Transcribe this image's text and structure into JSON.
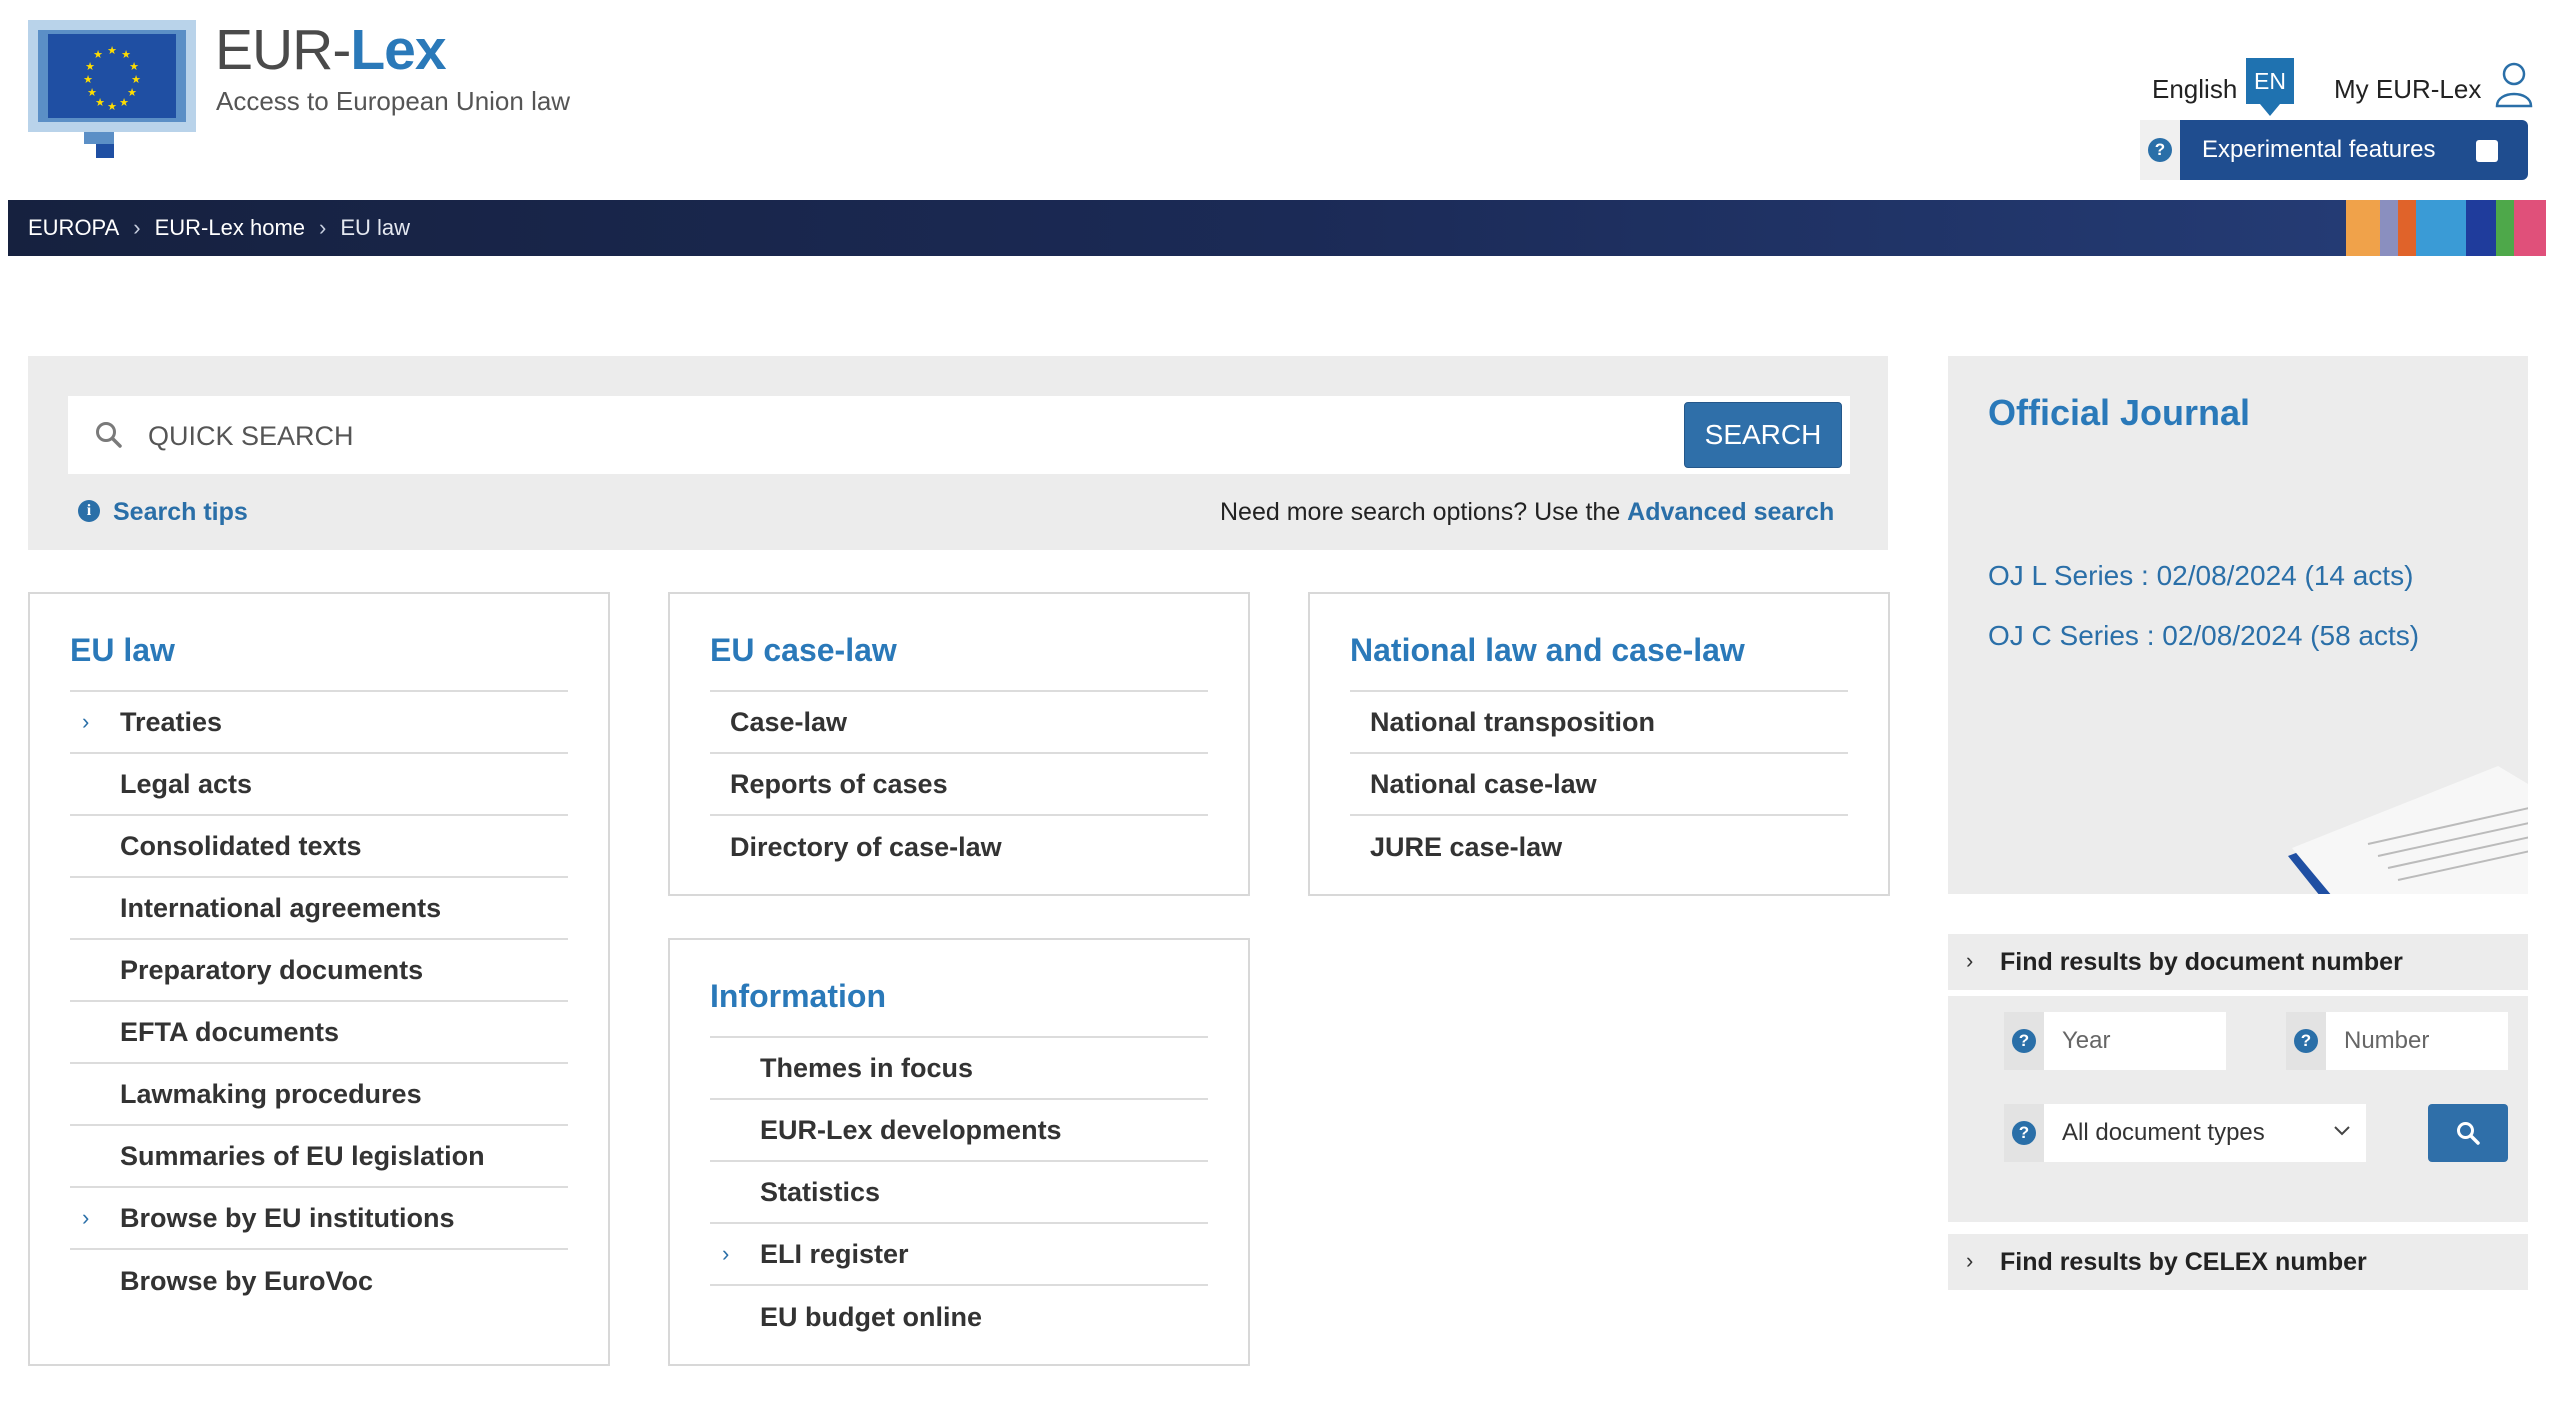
{
  "header": {
    "title_prefix": "EUR-",
    "title_strong": "Lex",
    "subtitle": "Access to European Union law",
    "language_label": "English",
    "language_code": "EN",
    "my_eurlex": "My EUR-Lex",
    "experimental_label": "Experimental features",
    "help_glyph": "?"
  },
  "breadcrumb": [
    "EUROPA",
    "EUR-Lex home",
    "EU law"
  ],
  "search": {
    "placeholder": "QUICK SEARCH",
    "button": "SEARCH",
    "tips": "Search tips",
    "advanced_prefix": "Need more search options? Use the ",
    "advanced_link": "Advanced search"
  },
  "cards": {
    "eu_law": {
      "title": "EU law",
      "items": [
        "Treaties",
        "Legal acts",
        "Consolidated texts",
        "International agreements",
        "Preparatory documents",
        "EFTA documents",
        "Lawmaking procedures",
        "Summaries of EU legislation",
        "Browse by EU institutions",
        "Browse by EuroVoc"
      ]
    },
    "case_law": {
      "title": "EU case-law",
      "items": [
        "Case-law",
        "Reports of cases",
        "Directory of case-law"
      ]
    },
    "national": {
      "title": "National law and case-law",
      "items": [
        "National transposition",
        "National case-law",
        "JURE case-law"
      ]
    },
    "information": {
      "title": "Information",
      "items": [
        "Themes in focus",
        "EUR-Lex developments",
        "Statistics",
        "ELI register",
        "EU budget online"
      ]
    }
  },
  "official_journal": {
    "title": "Official Journal",
    "oj_l": "OJ L Series : 02/08/2024 (14 acts)",
    "oj_c": "OJ C Series : 02/08/2024 (58 acts)"
  },
  "doc_number": {
    "title": "Find results by document number",
    "year_placeholder": "Year",
    "number_placeholder": "Number",
    "type_selected": "All document types"
  },
  "celex": {
    "title": "Find results by CELEX number"
  },
  "colors": {
    "brand_blue": "#2a79b9",
    "nav_dark": "#16213f",
    "button_blue": "#2f6fa9",
    "experimental_bg": "#1f4d8f"
  }
}
